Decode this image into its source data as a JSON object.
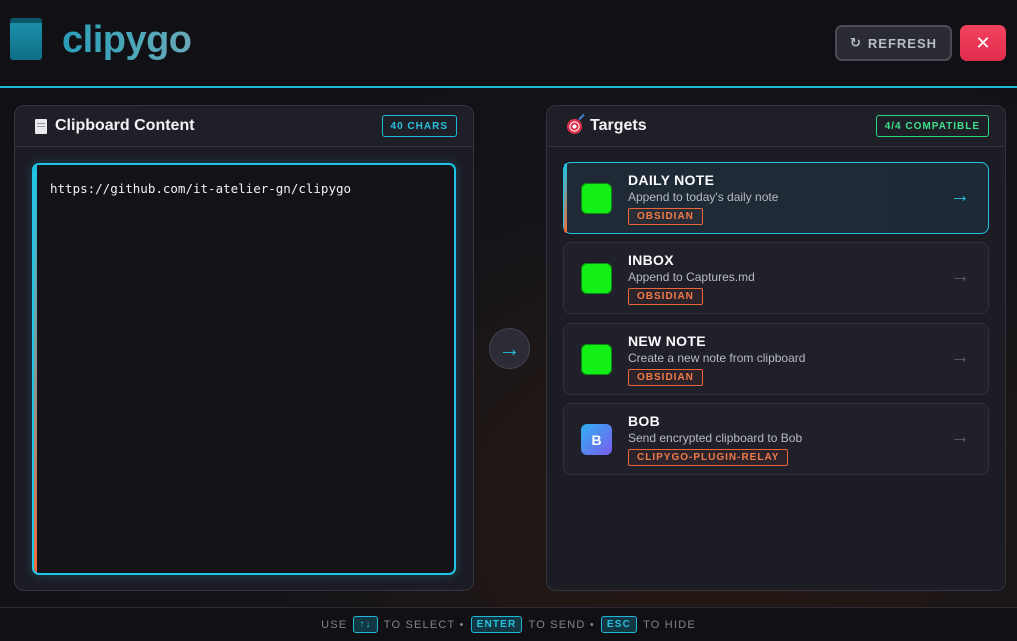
{
  "app": {
    "name": "clipygo",
    "refresh_label": "REFRESH",
    "refresh_icon": "↻",
    "close_label": "✕"
  },
  "clipboard": {
    "title": "Clipboard Content",
    "badge": "40 CHARS",
    "content": "https://github.com/it-atelier-gn/clipygo"
  },
  "send": {
    "arrow": "→"
  },
  "targets": {
    "title": "Targets",
    "badge": "4/4 COMPATIBLE",
    "items": [
      {
        "name": "DAILY NOTE",
        "description": "Append to today's daily note",
        "tag": "OBSIDIAN",
        "icon": "",
        "arrow": "→",
        "active": true
      },
      {
        "name": "INBOX",
        "description": "Append to Captures.md",
        "tag": "OBSIDIAN",
        "icon": "",
        "arrow": "→",
        "active": false
      },
      {
        "name": "NEW NOTE",
        "description": "Create a new note from clipboard",
        "tag": "OBSIDIAN",
        "icon": "",
        "arrow": "→",
        "active": false
      },
      {
        "name": "BOB",
        "description": "Send encrypted clipboard to Bob",
        "tag": "CLIPYGO-PLUGIN-RELAY",
        "icon": "B",
        "arrow": "→",
        "active": false
      }
    ]
  },
  "footer": {
    "use": "USE",
    "select_key": "↑↓",
    "to_select": "TO SELECT •",
    "enter_key": "ENTER",
    "to_send": "TO SEND •",
    "esc_key": "ESC",
    "to_hide": "TO HIDE"
  },
  "colors": {
    "accent": "#1fc4e6",
    "tag": "#f07a4a",
    "close": "#e22d4e",
    "compatible": "#3ee08a",
    "target_icon": "#12f017"
  }
}
